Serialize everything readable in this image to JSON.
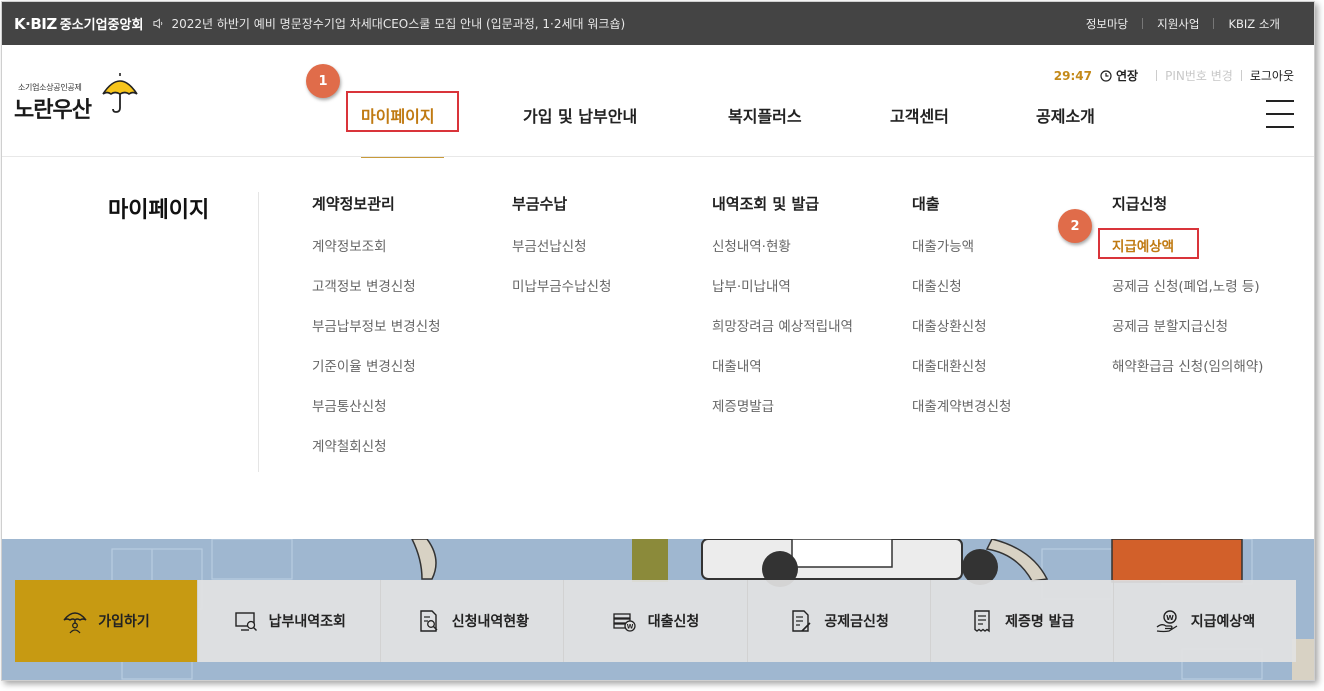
{
  "topbar": {
    "brand_mark": "K·BIZ",
    "brand_name": "중소기업중앙회",
    "notice": "2022년 하반기 예비 명문장수기업 차세대CEO스쿨 모집 안내 (입문과정, 1·2세대 워크숍)",
    "links": [
      "정보마당",
      "지원사업",
      "KBIZ 소개"
    ]
  },
  "logo": {
    "small": "소기업소상공인공제",
    "big": "노란우산"
  },
  "session": {
    "timer": "29:47",
    "extend": "연장",
    "pin_change": "PIN번호 변경",
    "logout": "로그아웃"
  },
  "gnb": {
    "items": [
      "마이페이지",
      "가입 및 납부안내",
      "복지플러스",
      "고객센터",
      "공제소개"
    ]
  },
  "badges": [
    "1",
    "2"
  ],
  "mega_menu": {
    "title": "마이페이지",
    "columns": [
      {
        "head": "계약정보관리",
        "items": [
          "계약정보조회",
          "고객정보 변경신청",
          "부금납부정보 변경신청",
          "기준이율 변경신청",
          "부금통산신청",
          "계약철회신청"
        ]
      },
      {
        "head": "부금수납",
        "items": [
          "부금선납신청",
          "미납부금수납신청"
        ]
      },
      {
        "head": "내역조회 및 발급",
        "items": [
          "신청내역·현황",
          "납부·미납내역",
          "희망장려금 예상적립내역",
          "대출내역",
          "제증명발급"
        ]
      },
      {
        "head": "대출",
        "items": [
          "대출가능액",
          "대출신청",
          "대출상환신청",
          "대출대환신청",
          "대출계약변경신청"
        ]
      },
      {
        "head": "지급신청",
        "items": [
          "지급예상액",
          "공제금 신청(폐업,노령 등)",
          "공제금 분할지급신청",
          "해약환급금 신청(임의해약)"
        ]
      }
    ]
  },
  "quick_menu": [
    "가입하기",
    "납부내역조회",
    "신청내역현황",
    "대출신청",
    "공제금신청",
    "제증명 발급",
    "지급예상액"
  ],
  "colors": {
    "accent": "#c07a12",
    "highlight_border": "#d9343a",
    "badge": "#e06c4a",
    "primary_button": "#c79a12"
  }
}
